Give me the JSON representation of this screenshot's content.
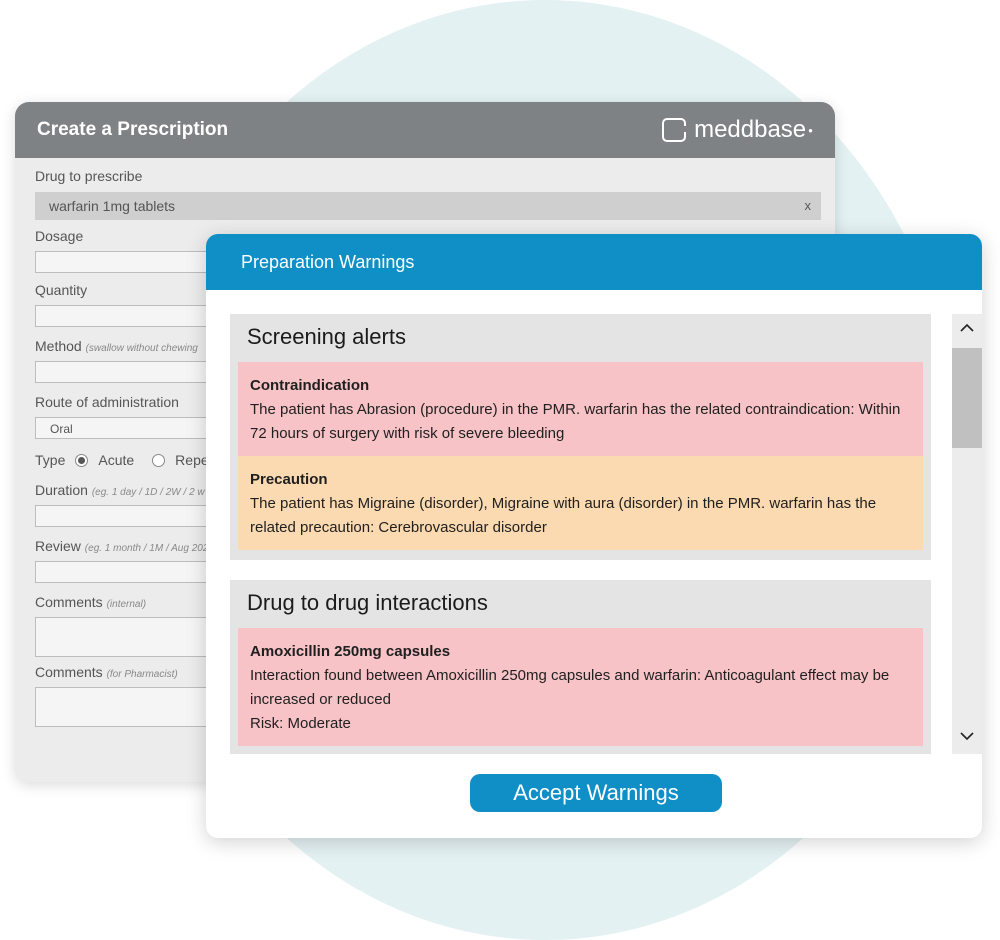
{
  "prescription": {
    "title": "Create a Prescription",
    "brand": "meddbase",
    "drug_label": "Drug to prescribe",
    "drug_value": "warfarin 1mg tablets",
    "drug_clear": "x",
    "dosage_label": "Dosage",
    "quantity_label": "Quantity",
    "method_label": "Method",
    "method_hint": "(swallow without chewing",
    "route_label": "Route of administration",
    "route_value": "Oral",
    "type_label": "Type",
    "type_options": [
      "Acute",
      "Repe"
    ],
    "type_selected": "Acute",
    "duration_label": "Duration",
    "duration_hint": "(eg. 1 day / 1D / 2W / 2 w",
    "review_label": "Review",
    "review_hint": "(eg. 1 month / 1M / Aug 202",
    "comments_internal_label": "Comments",
    "comments_internal_hint": "(internal)",
    "comments_pharmacist_label": "Comments",
    "comments_pharmacist_hint": "(for Pharmacist)"
  },
  "modal": {
    "title": "Preparation Warnings",
    "sections": [
      {
        "title": "Screening alerts",
        "alerts": [
          {
            "type": "Contraindication",
            "color": "#f7c3c7",
            "text": "The patient has Abrasion (procedure) in the PMR. warfarin has the related contraindication: Within 72 hours of surgery with risk of severe bleeding"
          },
          {
            "type": "Precaution",
            "color": "#fbdab1",
            "text": "The patient has Migraine (disorder), Migraine with aura (disorder) in the PMR. warfarin has the related precaution: Cerebrovascular disorder"
          }
        ]
      },
      {
        "title": "Drug to drug interactions",
        "alerts": [
          {
            "type": "Amoxicillin 250mg capsules",
            "color": "#f7c3c7",
            "text": "Interaction found between Amoxicillin 250mg capsules and warfarin: Anticoagulant effect may be increased or reduced",
            "risk": "Risk: Moderate"
          }
        ]
      }
    ],
    "accept_label": "Accept Warnings"
  },
  "colors": {
    "header_gray": "#7e8284",
    "accent_blue": "#0f8fc6",
    "alert_red": "#f7c3c7",
    "alert_orange": "#fbdab1"
  },
  "icons": {
    "scroll_up": "chevron-up-icon",
    "scroll_down": "chevron-down-icon",
    "clear": "close-icon",
    "logo": "meddbase-logo-icon"
  }
}
